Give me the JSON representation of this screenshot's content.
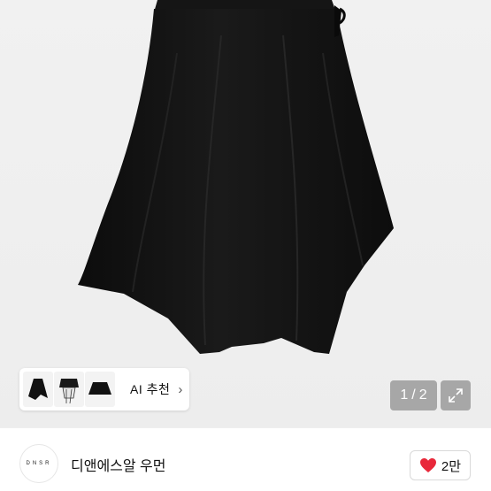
{
  "product_image": {
    "alt": "black asymmetric hem skirt"
  },
  "ai_recommend": {
    "label": "AI 추천",
    "chevron_icon": "chevron-right-icon",
    "thumbnails": [
      "skirt-thumb-1",
      "skirt-thumb-2",
      "skirt-thumb-3"
    ]
  },
  "gallery": {
    "current": "1",
    "separator": "/",
    "total": "2",
    "expand_icon": "expand-icon"
  },
  "seller": {
    "logo_text": "DNSR",
    "name": "디앤에스알 우먼"
  },
  "like": {
    "icon": "heart-icon",
    "count": "2만",
    "heart_color": "#e8283a"
  }
}
